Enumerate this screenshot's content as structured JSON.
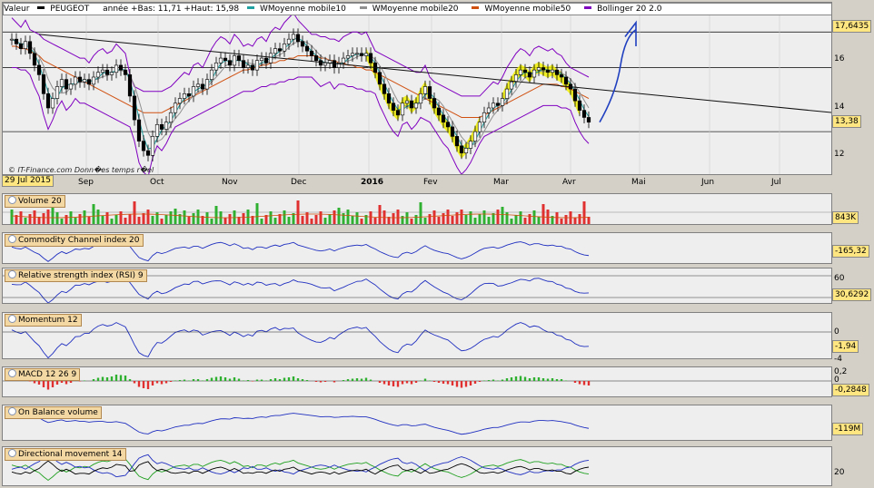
{
  "legend": {
    "valeur": "Valeur",
    "ticker": "PEUGEOT",
    "range": "année +Bas: 11,71 +Haut: 15,98",
    "ma10": "WMoyenne mobile10",
    "ma20": "WMoyenne mobile20",
    "ma50": "WMoyenne mobile50",
    "boll": "Bollinger 20 2.0"
  },
  "colors": {
    "ma10": "#20a0a0",
    "ma20": "#909090",
    "ma50": "#d05010",
    "boll": "#8000c0",
    "up": "#ffffff",
    "down": "#000000",
    "arrow": "#2040c0",
    "highlight": "#f0f000"
  },
  "price": {
    "last_tag": "13,38",
    "top_tag": "17,6435",
    "ticks": [
      "16",
      "14",
      "12"
    ],
    "credit": "© IT-Finance.com  Donn�es temps r�el",
    "chart_data": {
      "type": "candlestick",
      "ylim": [
        11.4,
        17.9
      ],
      "close": [
        16.9,
        16.7,
        16.5,
        16.8,
        16.3,
        15.8,
        15.4,
        14.6,
        14.0,
        14.4,
        14.9,
        15.2,
        14.8,
        15.0,
        15.3,
        15.1,
        15.2,
        15.0,
        15.3,
        15.5,
        15.6,
        15.4,
        15.5,
        15.8,
        15.6,
        15.4,
        14.5,
        13.5,
        12.6,
        12.2,
        12.0,
        12.8,
        13.3,
        13.1,
        13.4,
        13.8,
        14.2,
        14.4,
        14.6,
        14.5,
        14.9,
        15.0,
        14.8,
        15.2,
        15.6,
        15.9,
        16.1,
        16.0,
        15.8,
        16.2,
        16.0,
        15.7,
        15.8,
        15.6,
        16.0,
        16.1,
        15.9,
        16.3,
        16.5,
        16.4,
        16.7,
        16.9,
        17.1,
        16.8,
        16.6,
        16.4,
        16.2,
        16.0,
        15.8,
        15.9,
        16.0,
        15.7,
        15.9,
        16.1,
        16.2,
        16.3,
        16.3,
        16.2,
        16.3,
        15.9,
        15.5,
        15.0,
        14.6,
        14.2,
        13.9,
        13.7,
        14.2,
        14.3,
        14.0,
        14.2,
        14.6,
        14.9,
        14.4,
        14.0,
        13.7,
        13.4,
        13.2,
        12.8,
        12.4,
        12.1,
        12.3,
        12.6,
        13.0,
        13.4,
        13.8,
        14.0,
        14.2,
        14.1,
        14.4,
        14.8,
        15.1,
        15.4,
        15.6,
        15.5,
        15.3,
        15.6,
        15.7,
        15.6,
        15.5,
        15.6,
        15.4,
        15.3,
        15.0,
        14.8,
        14.3,
        13.9,
        13.6,
        13.4
      ],
      "ma50": [
        16.6,
        16.6,
        16.5,
        16.5,
        16.4,
        16.3,
        16.2,
        16.0,
        15.9,
        15.8,
        15.7,
        15.6,
        15.5,
        15.4,
        15.3,
        15.2,
        15.1,
        15.0,
        14.9,
        14.8,
        14.7,
        14.6,
        14.5,
        14.4,
        14.3,
        14.2,
        14.1,
        14.0,
        13.9,
        13.8,
        13.8,
        13.8,
        13.8,
        13.8,
        13.9,
        14.0,
        14.1,
        14.2,
        14.3,
        14.4,
        14.5,
        14.6,
        14.7,
        14.8,
        14.9,
        15.0,
        15.1,
        15.2,
        15.3,
        15.4,
        15.5,
        15.6,
        15.6,
        15.7,
        15.7,
        15.8,
        15.8,
        15.9,
        15.9,
        16.0,
        16.0,
        16.1,
        16.1,
        16.2,
        16.2,
        16.2,
        16.2,
        16.2,
        16.1,
        16.1,
        16.0,
        16.0,
        15.9,
        15.9,
        15.8,
        15.8,
        15.7,
        15.7,
        15.6,
        15.6,
        15.5,
        15.4,
        15.3,
        15.2,
        15.1,
        15.0,
        14.9,
        14.8,
        14.7,
        14.6,
        14.5,
        14.4,
        14.3,
        14.2,
        14.1,
        14.0,
        13.9,
        13.8,
        13.7,
        13.6,
        13.6,
        13.6,
        13.6,
        13.6,
        13.7,
        13.8,
        13.9,
        14.0,
        14.1,
        14.2,
        14.3,
        14.4,
        14.5,
        14.6,
        14.7,
        14.8,
        14.9,
        15.0,
        15.0,
        15.0,
        15.0,
        14.9,
        14.9,
        14.8,
        14.7,
        14.6,
        14.5,
        14.4
      ]
    }
  },
  "months": [
    {
      "label": "Sep",
      "bold": false
    },
    {
      "label": "Oct",
      "bold": false
    },
    {
      "label": "Nov",
      "bold": false
    },
    {
      "label": "Dec",
      "bold": false
    },
    {
      "label": "2016",
      "bold": true
    },
    {
      "label": "Fev",
      "bold": false
    },
    {
      "label": "Mar",
      "bold": false
    },
    {
      "label": "Avr",
      "bold": false
    },
    {
      "label": "Mai",
      "bold": false
    },
    {
      "label": "Jun",
      "bold": false
    },
    {
      "label": "Jul",
      "bold": false
    }
  ],
  "start_date": "29 Jul 2015",
  "indicators": {
    "volume": {
      "label": "Volume 20",
      "tag": "843K"
    },
    "cci": {
      "label": "Commodity Channel index 20",
      "tag": "-165,32"
    },
    "rsi": {
      "label": "Relative strength index (RSI) 9",
      "tag": "30,6292",
      "tick": "60"
    },
    "momentum": {
      "label": "Momentum 12",
      "tag": "-1,94",
      "tick": "0",
      "tick2": "-4"
    },
    "macd": {
      "label": "MACD 12 26 9",
      "tag": "-0,2848",
      "tick": "0,2",
      "tick2": "0"
    },
    "obv": {
      "label": "On Balance volume",
      "tag": "-119M"
    },
    "dmi": {
      "label": "Directional movement 14",
      "tick": "20"
    }
  }
}
